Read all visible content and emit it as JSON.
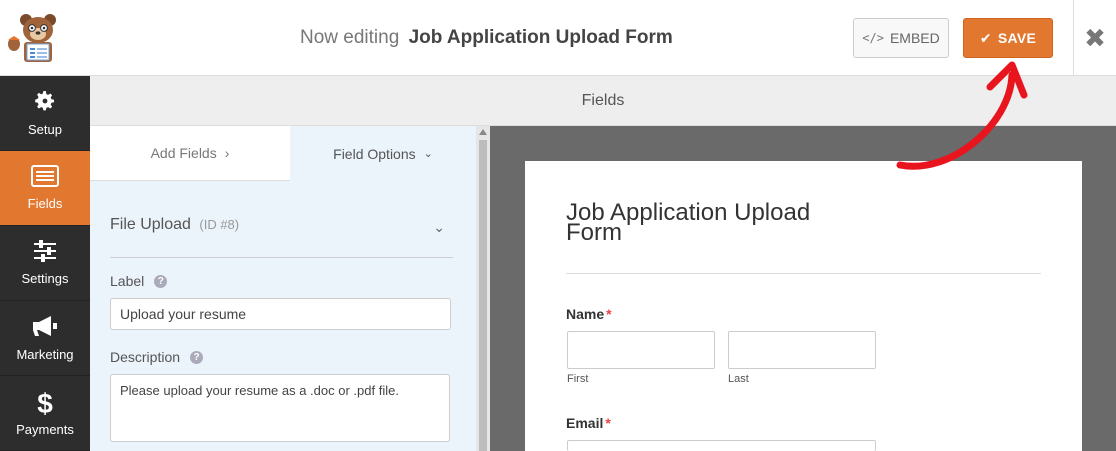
{
  "header": {
    "title_prefix": "Now editing",
    "form_name": "Job Application Upload Form",
    "embed_label": "EMBED",
    "save_label": "SAVE",
    "close_glyph": "✖"
  },
  "sidenav": {
    "items": [
      {
        "label": "Setup",
        "icon": "gear-icon"
      },
      {
        "label": "Fields",
        "icon": "fields-list-icon"
      },
      {
        "label": "Settings",
        "icon": "sliders-icon"
      },
      {
        "label": "Marketing",
        "icon": "megaphone-icon"
      },
      {
        "label": "Payments",
        "icon": "dollar-icon"
      }
    ],
    "active": "Fields"
  },
  "section_header": "Fields",
  "panel": {
    "tab_add": "Add Fields",
    "tab_options": "Field Options",
    "field_name": "File Upload",
    "field_id": "(ID #8)",
    "label_caption": "Label",
    "label_value": "Upload your resume",
    "description_caption": "Description",
    "description_value": "Please upload your resume as a .doc or .pdf file."
  },
  "preview": {
    "form_title": "Job Application Upload Form",
    "name_label": "Name",
    "first_sublabel": "First",
    "last_sublabel": "Last",
    "email_label": "Email",
    "required_mark": "*"
  },
  "colors": {
    "accent": "#e27730",
    "nav_bg": "#2d2d2d",
    "panel_bg": "#ebf3fb",
    "preview_bg": "#6a6a6a",
    "annotation_arrow": "#e8141e"
  }
}
